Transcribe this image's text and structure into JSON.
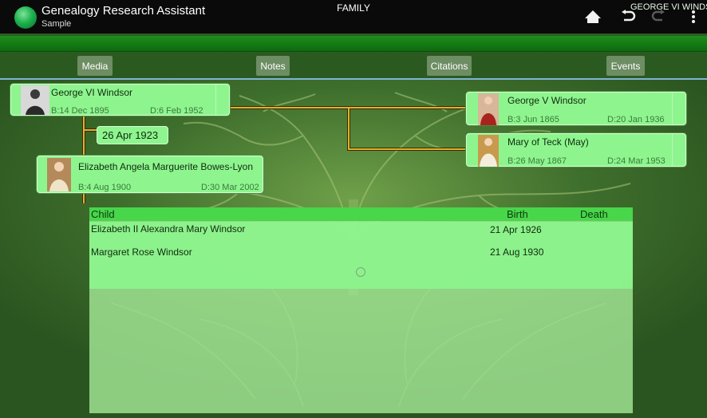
{
  "app": {
    "title": "Genealogy Research Assistant",
    "subtitle": "Sample",
    "icons": [
      "home-icon",
      "undo-icon",
      "redo-icon",
      "overflow-menu-icon"
    ]
  },
  "context": {
    "title": "FAMILY",
    "person": "GEORGE VI WINDSOR"
  },
  "toolbar": {
    "media": "Media",
    "notes": "Notes",
    "citations": "Citations",
    "events": "Events"
  },
  "father": {
    "name": "George VI Windsor",
    "birth": "B:14 Dec 1895",
    "death": "D:6 Feb 1952"
  },
  "marriage": {
    "date": "26 Apr 1923"
  },
  "mother": {
    "name": "Elizabeth Angela Marguerite Bowes-Lyon",
    "birth": "B:4 Aug 1900",
    "death": "D:30 Mar 2002"
  },
  "paternal_grandfather": {
    "name": "George V Windsor",
    "birth": "B:3 Jun 1865",
    "death": "D:20 Jan 1936"
  },
  "paternal_grandmother": {
    "name": "Mary of Teck (May)",
    "birth": "B:26 May 1867",
    "death": "D:24 Mar 1953"
  },
  "children": {
    "headers": {
      "child": "Child",
      "birth": "Birth",
      "death": "Death"
    },
    "rows": [
      {
        "name": "Elizabeth II Alexandra Mary Windsor",
        "birth": "21 Apr 1926",
        "death": ""
      },
      {
        "name": "Margaret Rose Windsor",
        "birth": "21 Aug 1930",
        "death": ""
      }
    ]
  },
  "colors": {
    "background": "#2f5b22",
    "card": "#8ef58e",
    "header_green": "#48d64a",
    "connector": "#d8a820"
  }
}
